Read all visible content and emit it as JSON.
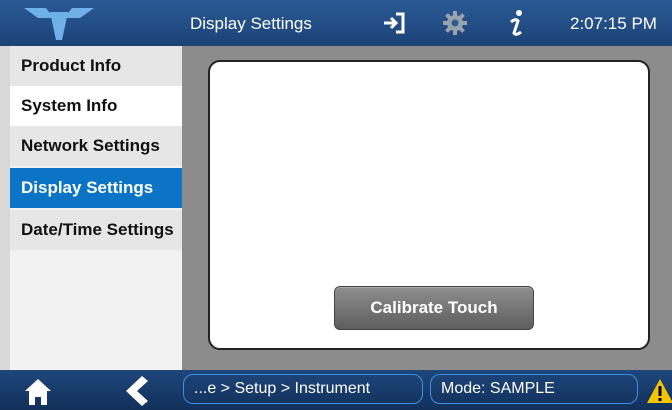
{
  "header": {
    "title": "Display Settings",
    "time": "2:07:15 PM",
    "logo_icon": "teledyne-logo-icon",
    "exit_icon": "exit-icon",
    "settings_icon": "gear-icon",
    "info_icon": "info-icon"
  },
  "sidebar": {
    "items": [
      {
        "label": "Product Info"
      },
      {
        "label": "System Info"
      },
      {
        "label": "Network Settings"
      },
      {
        "label": "Display Settings",
        "active": true
      },
      {
        "label": "Date/Time Settings"
      }
    ]
  },
  "main": {
    "calibrate_label": "Calibrate Touch"
  },
  "footer": {
    "breadcrumb": "...e > Setup > Instrument",
    "mode": "Mode: SAMPLE",
    "home_icon": "home-icon",
    "back_icon": "back-icon",
    "warning_icon": "warning-icon"
  },
  "colors": {
    "accent": "#0b74c4",
    "header_bg": "#1c4277",
    "content_bg": "#8c8c8c"
  }
}
